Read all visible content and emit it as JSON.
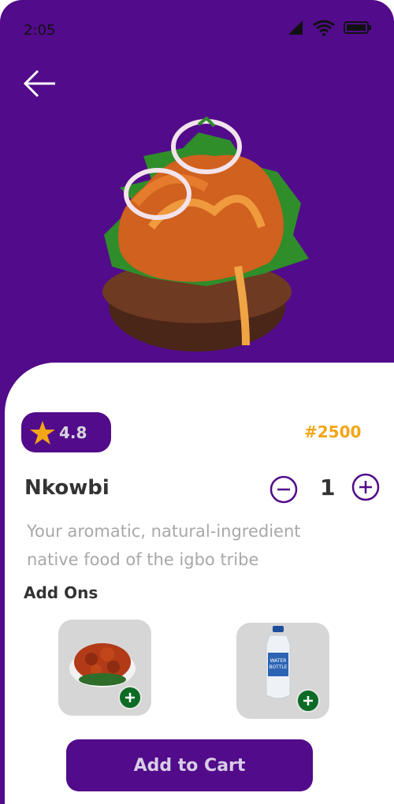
{
  "status": {
    "time": "2:05",
    "icons": [
      "signal-icon",
      "wifi-icon",
      "battery-icon"
    ]
  },
  "nav": {
    "back_icon": "arrow-left-icon"
  },
  "product": {
    "image": "nkwobi-dish-image",
    "rating": "4.8",
    "price": "#2500",
    "name": "Nkowbi",
    "quantity": "1",
    "description_line1": "Your aromatic, natural-ingredient",
    "description_line2": "native food of the igbo  tribe"
  },
  "addons": {
    "title": "Add Ons",
    "items": [
      {
        "image": "fried-meat-bowl-image"
      },
      {
        "image": "water-bottle-image",
        "label1": "WATER",
        "label2": "BOTTLE"
      }
    ]
  },
  "cart": {
    "label": "Add to Cart"
  },
  "colors": {
    "primary": "#520b8a",
    "accent": "#f2a516",
    "addon_green": "#0c6b25",
    "text_muted": "#a8a8a8"
  }
}
